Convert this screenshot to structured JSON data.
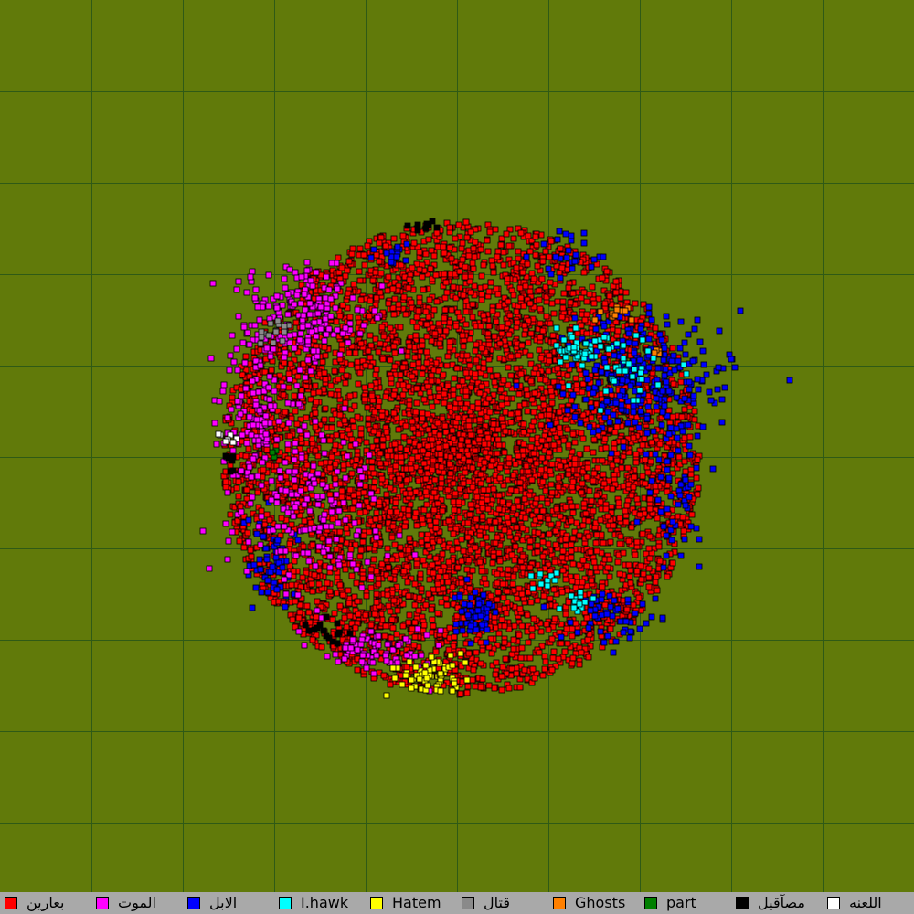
{
  "map": {
    "background_color": "#617a0a",
    "grid_color": "#2f5a16",
    "grid_spacing_tiles": 100,
    "grid_shown": true,
    "map_tiles": 1000
  },
  "legend": [
    {
      "label": "بعارين",
      "color": "#ff0000"
    },
    {
      "label": "الموت",
      "color": "#ff00ff"
    },
    {
      "label": "الابل",
      "color": "#0000ff"
    },
    {
      "label": "I.hawk",
      "color": "#00ffff"
    },
    {
      "label": "Hatem",
      "color": "#ffff00"
    },
    {
      "label": "قتال",
      "color": "#8a8a8a"
    },
    {
      "label": "Ghosts",
      "color": "#ff8000"
    },
    {
      "label": "part",
      "color": "#007f00"
    },
    {
      "label": "مصآقيل",
      "color": "#000000"
    },
    {
      "label": "اللعنه",
      "color": "#ffffff"
    }
  ]
}
